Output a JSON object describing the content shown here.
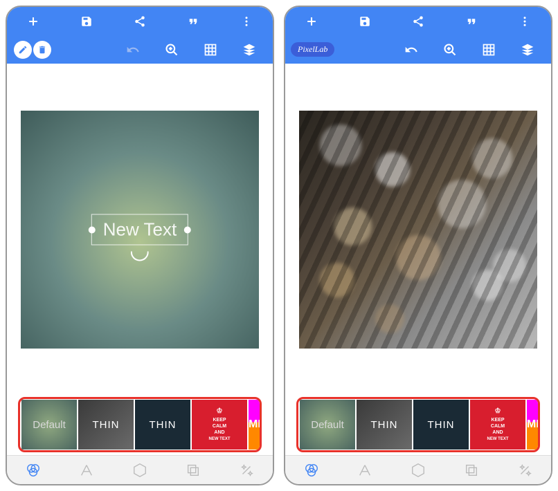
{
  "brand": "PixelLab",
  "canvas_text": "New Text",
  "toolbar_icons": {
    "add": "add",
    "save": "save",
    "share": "share",
    "quote": "quote",
    "more": "more",
    "edit": "edit",
    "delete": "delete",
    "undo": "undo",
    "zoom": "zoom",
    "grid": "grid",
    "layers": "layers"
  },
  "templates": [
    {
      "label": "Default",
      "style": "default"
    },
    {
      "label": "THIN",
      "style": "thin1"
    },
    {
      "label": "THIN",
      "style": "thin2"
    },
    {
      "label_top": "KEEP\nCALM\nAND",
      "label_bottom": "NEW TEXT",
      "style": "keepcalm"
    },
    {
      "label": "ME",
      "style": "rainbow"
    }
  ],
  "tabs": {
    "filters": "filters-icon",
    "text": "text-icon",
    "shapes": "shapes-icon",
    "layers": "layers-icon",
    "effects": "effects-icon"
  }
}
